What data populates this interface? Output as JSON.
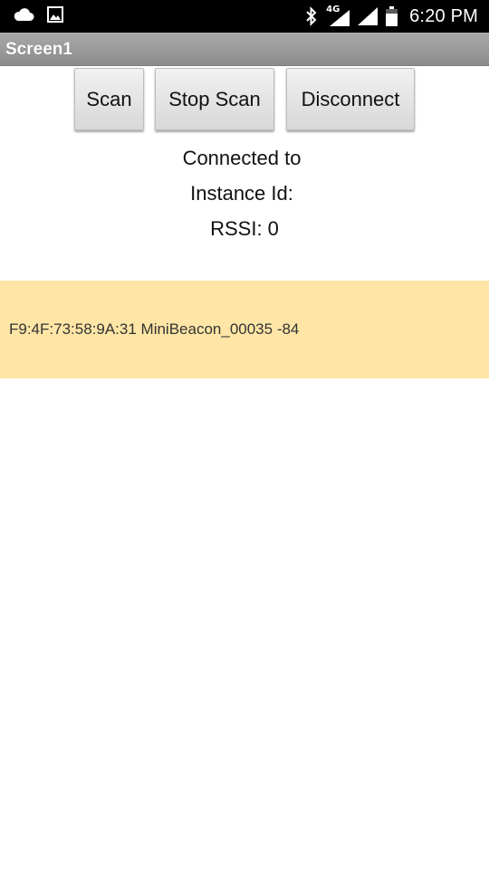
{
  "status_bar": {
    "icons_left": [
      "cloud-icon",
      "image-icon"
    ],
    "icons_right": [
      "bluetooth-icon",
      "mobile-signal-icon",
      "wifi-signal-icon",
      "battery-icon"
    ],
    "network_type": "4G",
    "time": "6:20 PM"
  },
  "title_bar": {
    "title": "Screen1"
  },
  "buttons": {
    "scan": "Scan",
    "stop_scan": "Stop Scan",
    "disconnect": "Disconnect"
  },
  "info": {
    "connected": "Connected to",
    "instance_id": "Instance Id:",
    "rssi": "RSSI: 0"
  },
  "device_list": {
    "items": [
      {
        "text": "F9:4F:73:58:9A:31 MiniBeacon_00035 -84"
      }
    ]
  },
  "colors": {
    "status_bar_bg": "#000000",
    "title_bar_bg": "#9a9a9a",
    "list_highlight": "#ffe6a6",
    "button_bg": "#e4e4e4"
  }
}
